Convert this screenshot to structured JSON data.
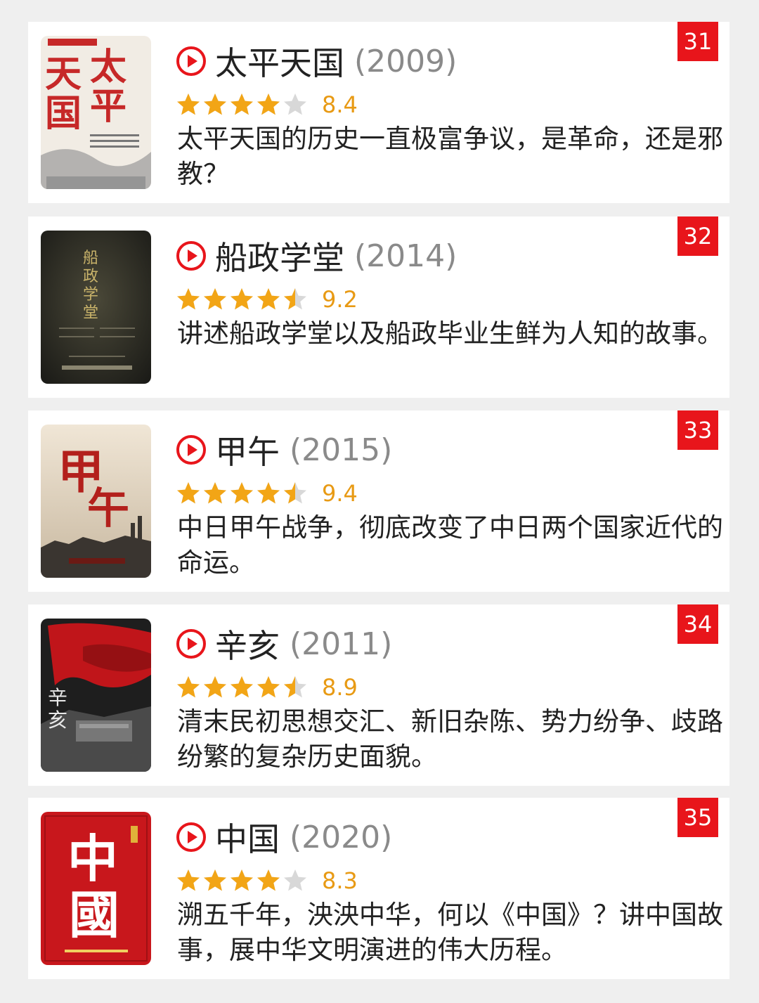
{
  "colors": {
    "accent_red": "#e8151b",
    "star_gold": "#f2a516",
    "star_gray": "#d8d8d8",
    "score": "#e89a14",
    "year_gray": "#8a8a8a"
  },
  "items": [
    {
      "rank": "31",
      "title": "太平天国",
      "year": "(2009)",
      "rating": 4,
      "score": "8.4",
      "desc": "太平天国的历史一直极富争议，是革命，还是邪教？",
      "poster": {
        "chars": [
          "天",
          "太",
          "国",
          "平"
        ]
      }
    },
    {
      "rank": "32",
      "title": "船政学堂",
      "year": "(2014)",
      "rating": 4.5,
      "score": "9.2",
      "desc": "讲述船政学堂以及船政毕业生鲜为人知的故事。",
      "poster": {
        "chars": [
          "船",
          "政",
          "学",
          "堂"
        ]
      }
    },
    {
      "rank": "33",
      "title": "甲午",
      "year": "(2015)",
      "rating": 4.5,
      "score": "9.4",
      "desc": "中日甲午战争，彻底改变了中日两个国家近代的命运。",
      "poster": {
        "chars": [
          "甲",
          "午"
        ]
      }
    },
    {
      "rank": "34",
      "title": "辛亥",
      "year": "(2011)",
      "rating": 4.5,
      "score": "8.9",
      "desc": "清末民初思想交汇、新旧杂陈、势力纷争、歧路纷繁的复杂历史面貌。",
      "poster": {
        "chars": [
          "辛",
          "亥"
        ]
      }
    },
    {
      "rank": "35",
      "title": "中国",
      "year": "(2020)",
      "rating": 4,
      "score": "8.3",
      "desc": "溯五千年，泱泱中华，何以《中国》？讲中国故事，展中华文明演进的伟大历程。",
      "poster": {
        "chars": [
          "中",
          "國"
        ]
      }
    }
  ]
}
